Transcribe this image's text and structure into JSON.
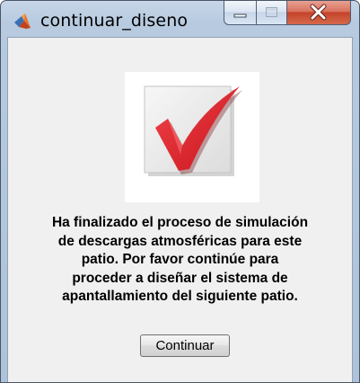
{
  "window": {
    "title": "continuar_diseno",
    "icon": "matlab-icon"
  },
  "titlebar_buttons": {
    "minimize": "minimize-icon",
    "maximize": "maximize-icon",
    "close": "close-icon"
  },
  "dialog": {
    "image": "checkmark-icon",
    "message_lines": [
      "Ha finalizado el proceso de simulación",
      "de descargas atmosféricas para este",
      "patio.  Por favor continúe para",
      "proceder a diseñar el sistema de",
      "apantallamiento del siguiente patio."
    ],
    "continue_label": "Continuar"
  },
  "colors": {
    "check_red": "#e3242b",
    "close_red": "#c4432a",
    "frame_blue": "#b7cadf",
    "client_bg": "#f0f0f0"
  }
}
